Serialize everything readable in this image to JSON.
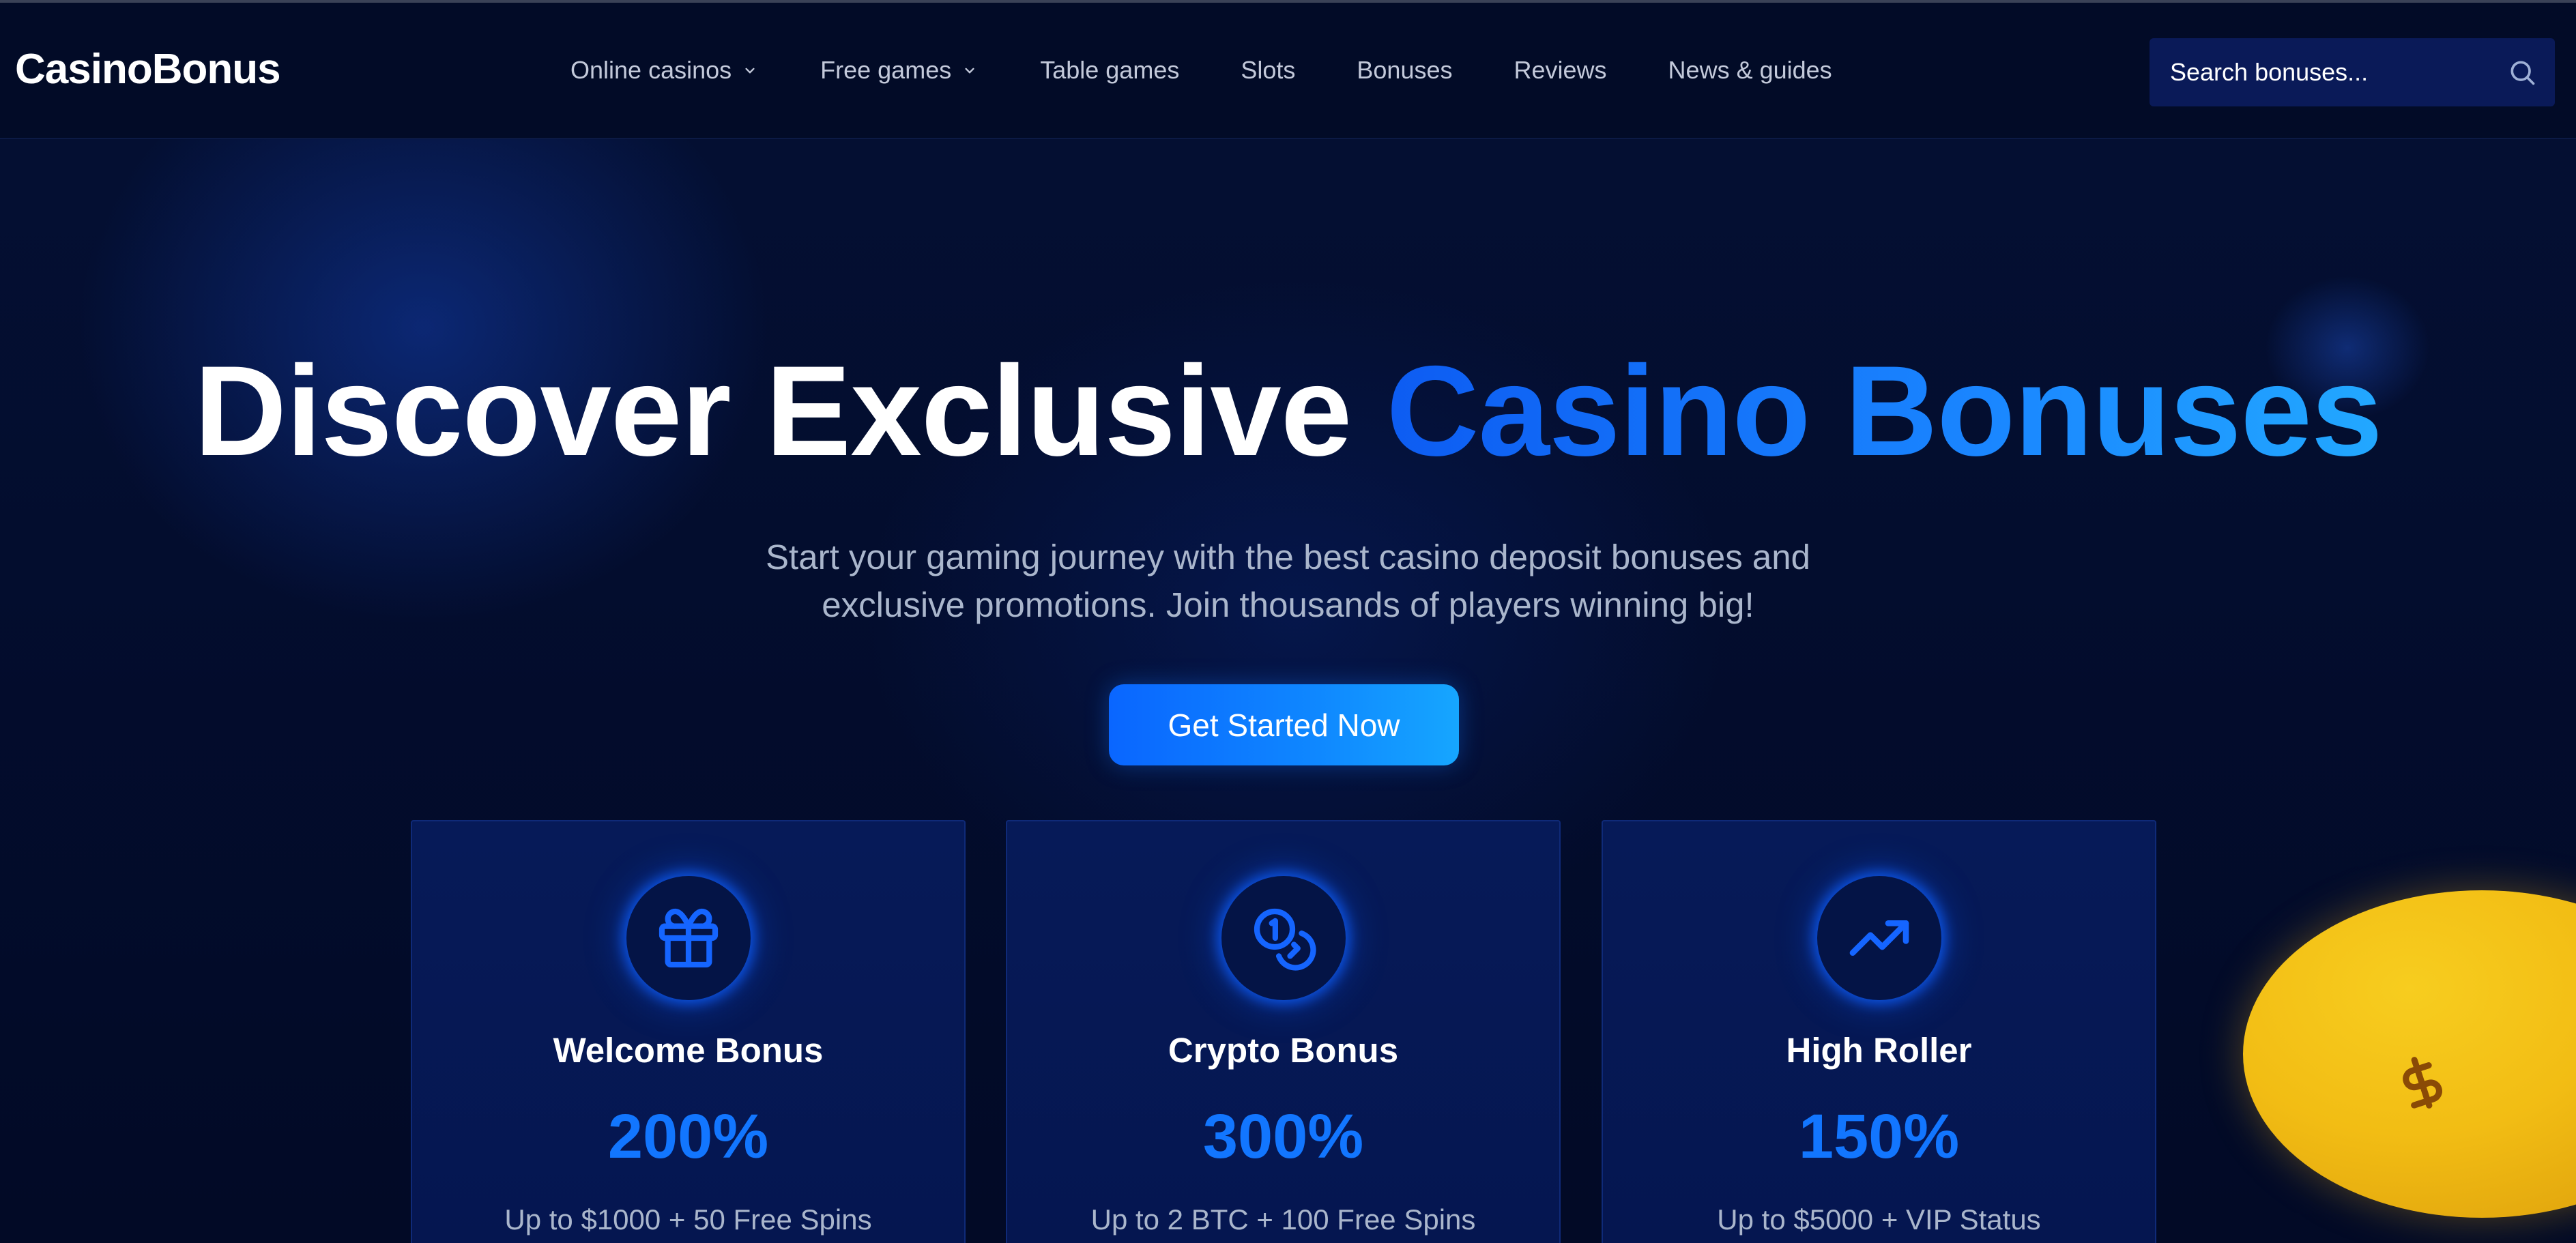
{
  "header": {
    "brand": "CasinoBonus",
    "nav": [
      {
        "label": "Online casinos",
        "has_dropdown": true
      },
      {
        "label": "Free games",
        "has_dropdown": true
      },
      {
        "label": "Table games",
        "has_dropdown": false
      },
      {
        "label": "Slots",
        "has_dropdown": false
      },
      {
        "label": "Bonuses",
        "has_dropdown": false
      },
      {
        "label": "Reviews",
        "has_dropdown": false
      },
      {
        "label": "News & guides",
        "has_dropdown": false
      }
    ],
    "search": {
      "placeholder": "Search bonuses...",
      "icon": "search-icon"
    }
  },
  "hero": {
    "title_plain": "Discover Exclusive",
    "title_accent": "Casino Bonuses",
    "subtitle_line1": "Start your gaming journey with the best casino deposit bonuses and",
    "subtitle_line2": "exclusive promotions. Join thousands of players winning big!",
    "cta_label": "Get Started Now"
  },
  "cards": [
    {
      "icon": "gift-icon",
      "title": "Welcome Bonus",
      "value": "200%",
      "description": "Up to $1000 + 50 Free Spins"
    },
    {
      "icon": "coins-icon",
      "title": "Crypto Bonus",
      "value": "300%",
      "description": "Up to 2 BTC + 100 Free Spins"
    },
    {
      "icon": "trending-up-icon",
      "title": "High Roller",
      "value": "150%",
      "description": "Up to $5000 + VIP Status"
    }
  ],
  "decor": {
    "coin_icon": "dollar-icon"
  },
  "colors": {
    "background": "#020b2a",
    "accent_blue": "#1276ff",
    "cta_gradient_start": "#0a66ff",
    "cta_gradient_end": "#16a6ff",
    "coin_gold": "#f2bd14",
    "muted_text": "#aab6cc"
  }
}
